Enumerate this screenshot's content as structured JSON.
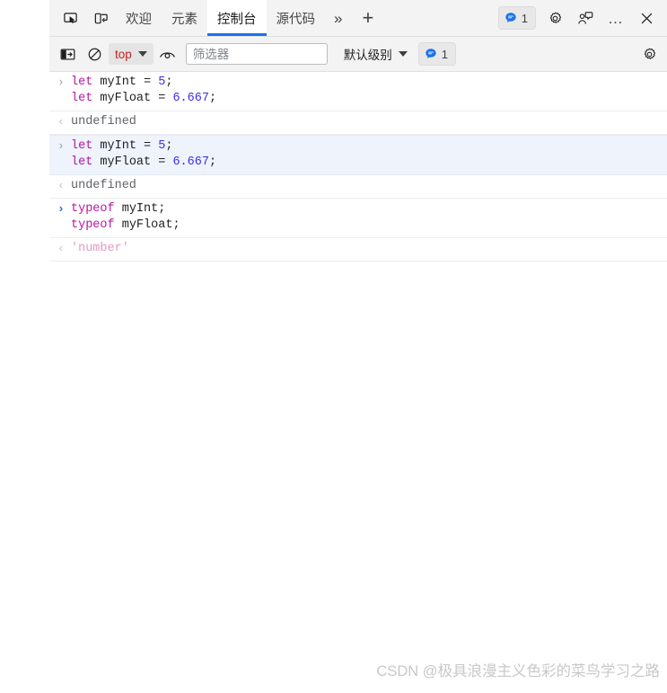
{
  "window": {
    "title": "Microsoft Edge DevTools - Console"
  },
  "tabstrip": {
    "inspect_icon": "inspect-element-icon",
    "device_icon": "device-toolbar-icon",
    "tabs": [
      {
        "label": "欢迎",
        "name": "tab-welcome",
        "active": false
      },
      {
        "label": "元素",
        "name": "tab-elements",
        "active": false
      },
      {
        "label": "控制台",
        "name": "tab-console",
        "active": true
      },
      {
        "label": "源代码",
        "name": "tab-sources",
        "active": false
      }
    ],
    "more_tabs_label": "»",
    "add_tab_label": "+",
    "issues_count": "1",
    "settings_icon": "gear-icon",
    "feedback_icon": "feedback-icon",
    "more_options_label": "…",
    "close_label": "✕"
  },
  "console_toolbar": {
    "sidebar_toggle_icon": "console-sidebar-toggle-icon",
    "clear_console_icon": "clear-console-icon",
    "context_label": "top",
    "live_expression_icon": "eye-icon",
    "filter_placeholder": "筛选器",
    "filter_value": "",
    "level_label": "默认级别",
    "issues_count": "1",
    "settings_icon": "gear-icon"
  },
  "console_entries": [
    {
      "type": "command",
      "focused": false,
      "prompt": "›",
      "prompt_active": false,
      "lines": [
        [
          {
            "t": "let",
            "c": "tk-kw"
          },
          {
            "t": " ",
            "c": "tk-op"
          },
          {
            "t": "myInt",
            "c": "tk-id"
          },
          {
            "t": " = ",
            "c": "tk-op"
          },
          {
            "t": "5",
            "c": "tk-num"
          },
          {
            "t": ";",
            "c": "tk-punct"
          }
        ],
        [
          {
            "t": "let",
            "c": "tk-kw"
          },
          {
            "t": " ",
            "c": "tk-op"
          },
          {
            "t": "myFloat",
            "c": "tk-id"
          },
          {
            "t": " = ",
            "c": "tk-op"
          },
          {
            "t": "6.667",
            "c": "tk-num"
          },
          {
            "t": ";",
            "c": "tk-punct"
          }
        ]
      ]
    },
    {
      "type": "result",
      "prompt": "‹",
      "value": "undefined",
      "value_class": "res-undefined"
    },
    {
      "type": "command",
      "focused": true,
      "prompt": "›",
      "prompt_active": false,
      "lines": [
        [
          {
            "t": "let",
            "c": "tk-kw"
          },
          {
            "t": " ",
            "c": "tk-op"
          },
          {
            "t": "myInt",
            "c": "tk-id"
          },
          {
            "t": " = ",
            "c": "tk-op"
          },
          {
            "t": "5",
            "c": "tk-num"
          },
          {
            "t": ";",
            "c": "tk-punct"
          }
        ],
        [
          {
            "t": "let",
            "c": "tk-kw"
          },
          {
            "t": " ",
            "c": "tk-op"
          },
          {
            "t": "myFloat",
            "c": "tk-id"
          },
          {
            "t": " = ",
            "c": "tk-op"
          },
          {
            "t": "6.667",
            "c": "tk-num"
          },
          {
            "t": ";",
            "c": "tk-punct"
          }
        ]
      ]
    },
    {
      "type": "result",
      "prompt": "‹",
      "value": "undefined",
      "value_class": "res-undefined"
    },
    {
      "type": "command",
      "focused": false,
      "prompt": "›",
      "prompt_active": true,
      "lines": [
        [
          {
            "t": "typeof",
            "c": "tk-kw"
          },
          {
            "t": " ",
            "c": "tk-op"
          },
          {
            "t": "myInt",
            "c": "tk-id"
          },
          {
            "t": ";",
            "c": "tk-punct"
          }
        ],
        [
          {
            "t": "typeof",
            "c": "tk-kw"
          },
          {
            "t": " ",
            "c": "tk-op"
          },
          {
            "t": "myFloat",
            "c": "tk-id"
          },
          {
            "t": ";",
            "c": "tk-punct"
          }
        ]
      ]
    },
    {
      "type": "result",
      "prompt": "‹",
      "value": "'number'",
      "value_class": "res-string"
    }
  ],
  "watermark": {
    "text": "CSDN @极具浪漫主义色彩的菜鸟学习之路"
  },
  "colors": {
    "accent_blue": "#1a73e8",
    "toolbar_bg": "#f3f3f3",
    "keyword": "#b5179e",
    "number": "#3b2ee8",
    "string": "#e29ac5",
    "focused_row": "#eef3fc"
  }
}
